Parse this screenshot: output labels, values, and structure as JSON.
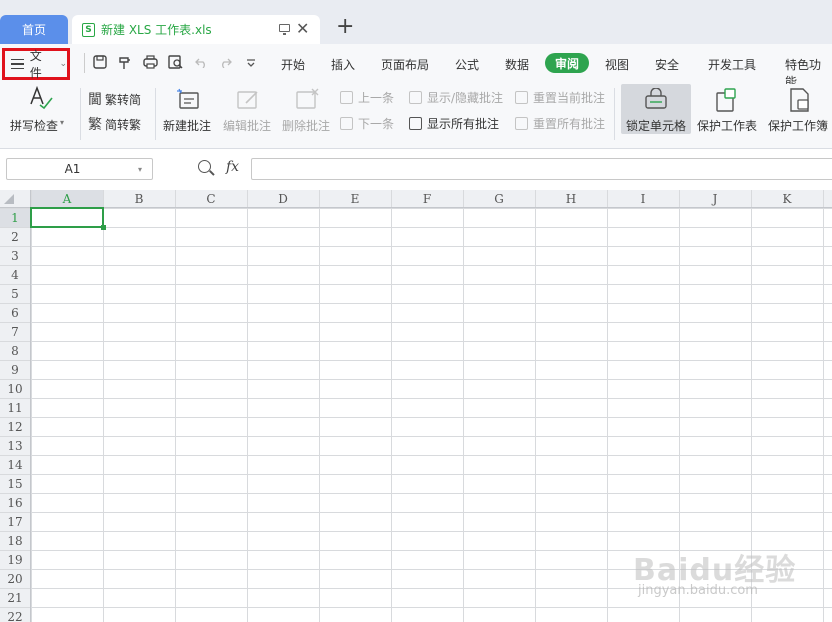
{
  "tabs": {
    "home_label": "首页",
    "document_label": "新建 XLS 工作表.xls",
    "xls_badge": "S",
    "add_label": "+",
    "close_label": "✕"
  },
  "menu": {
    "file_label": "文件",
    "file_caret": "⌄",
    "items": [
      "开始",
      "插入",
      "页面布局",
      "公式",
      "数据",
      "审阅",
      "视图",
      "安全",
      "开发工具",
      "特色功能"
    ],
    "active_index": 5,
    "active_color": "#2ea44f"
  },
  "ribbon": {
    "spell_check": "拼写检查",
    "spell_caret": "▾",
    "trad_to_simp": "繁转简",
    "simp_to_trad": "简转繁",
    "new_comment": "新建批注",
    "edit_comment": "编辑批注",
    "delete_comment": "删除批注",
    "prev_comment": "上一条",
    "next_comment": "下一条",
    "show_hide_comment": "显示/隐藏批注",
    "show_all_comments": "显示所有批注",
    "reset_current_comment": "重置当前批注",
    "reset_all_comments": "重置所有批注",
    "lock_cell": "锁定单元格",
    "protect_sheet": "保护工作表",
    "protect_workbook": "保护工作簿"
  },
  "formula_bar": {
    "name_box": "A1",
    "fx_label": "fx",
    "formula_value": ""
  },
  "grid": {
    "columns": [
      "A",
      "B",
      "C",
      "D",
      "E",
      "F",
      "G",
      "H",
      "I",
      "J",
      "K"
    ],
    "rows": [
      "1",
      "2",
      "3",
      "4",
      "5",
      "6",
      "7",
      "8",
      "9",
      "10",
      "11",
      "12",
      "13",
      "14",
      "15",
      "16",
      "17",
      "18",
      "19",
      "20",
      "21",
      "22"
    ],
    "selected_cell": "A1",
    "selection_color": "#2e9e48",
    "brand_blue": "#5b8fea"
  },
  "watermark": {
    "logo": "Baidu经验",
    "url": "jingyan.baidu.com"
  }
}
